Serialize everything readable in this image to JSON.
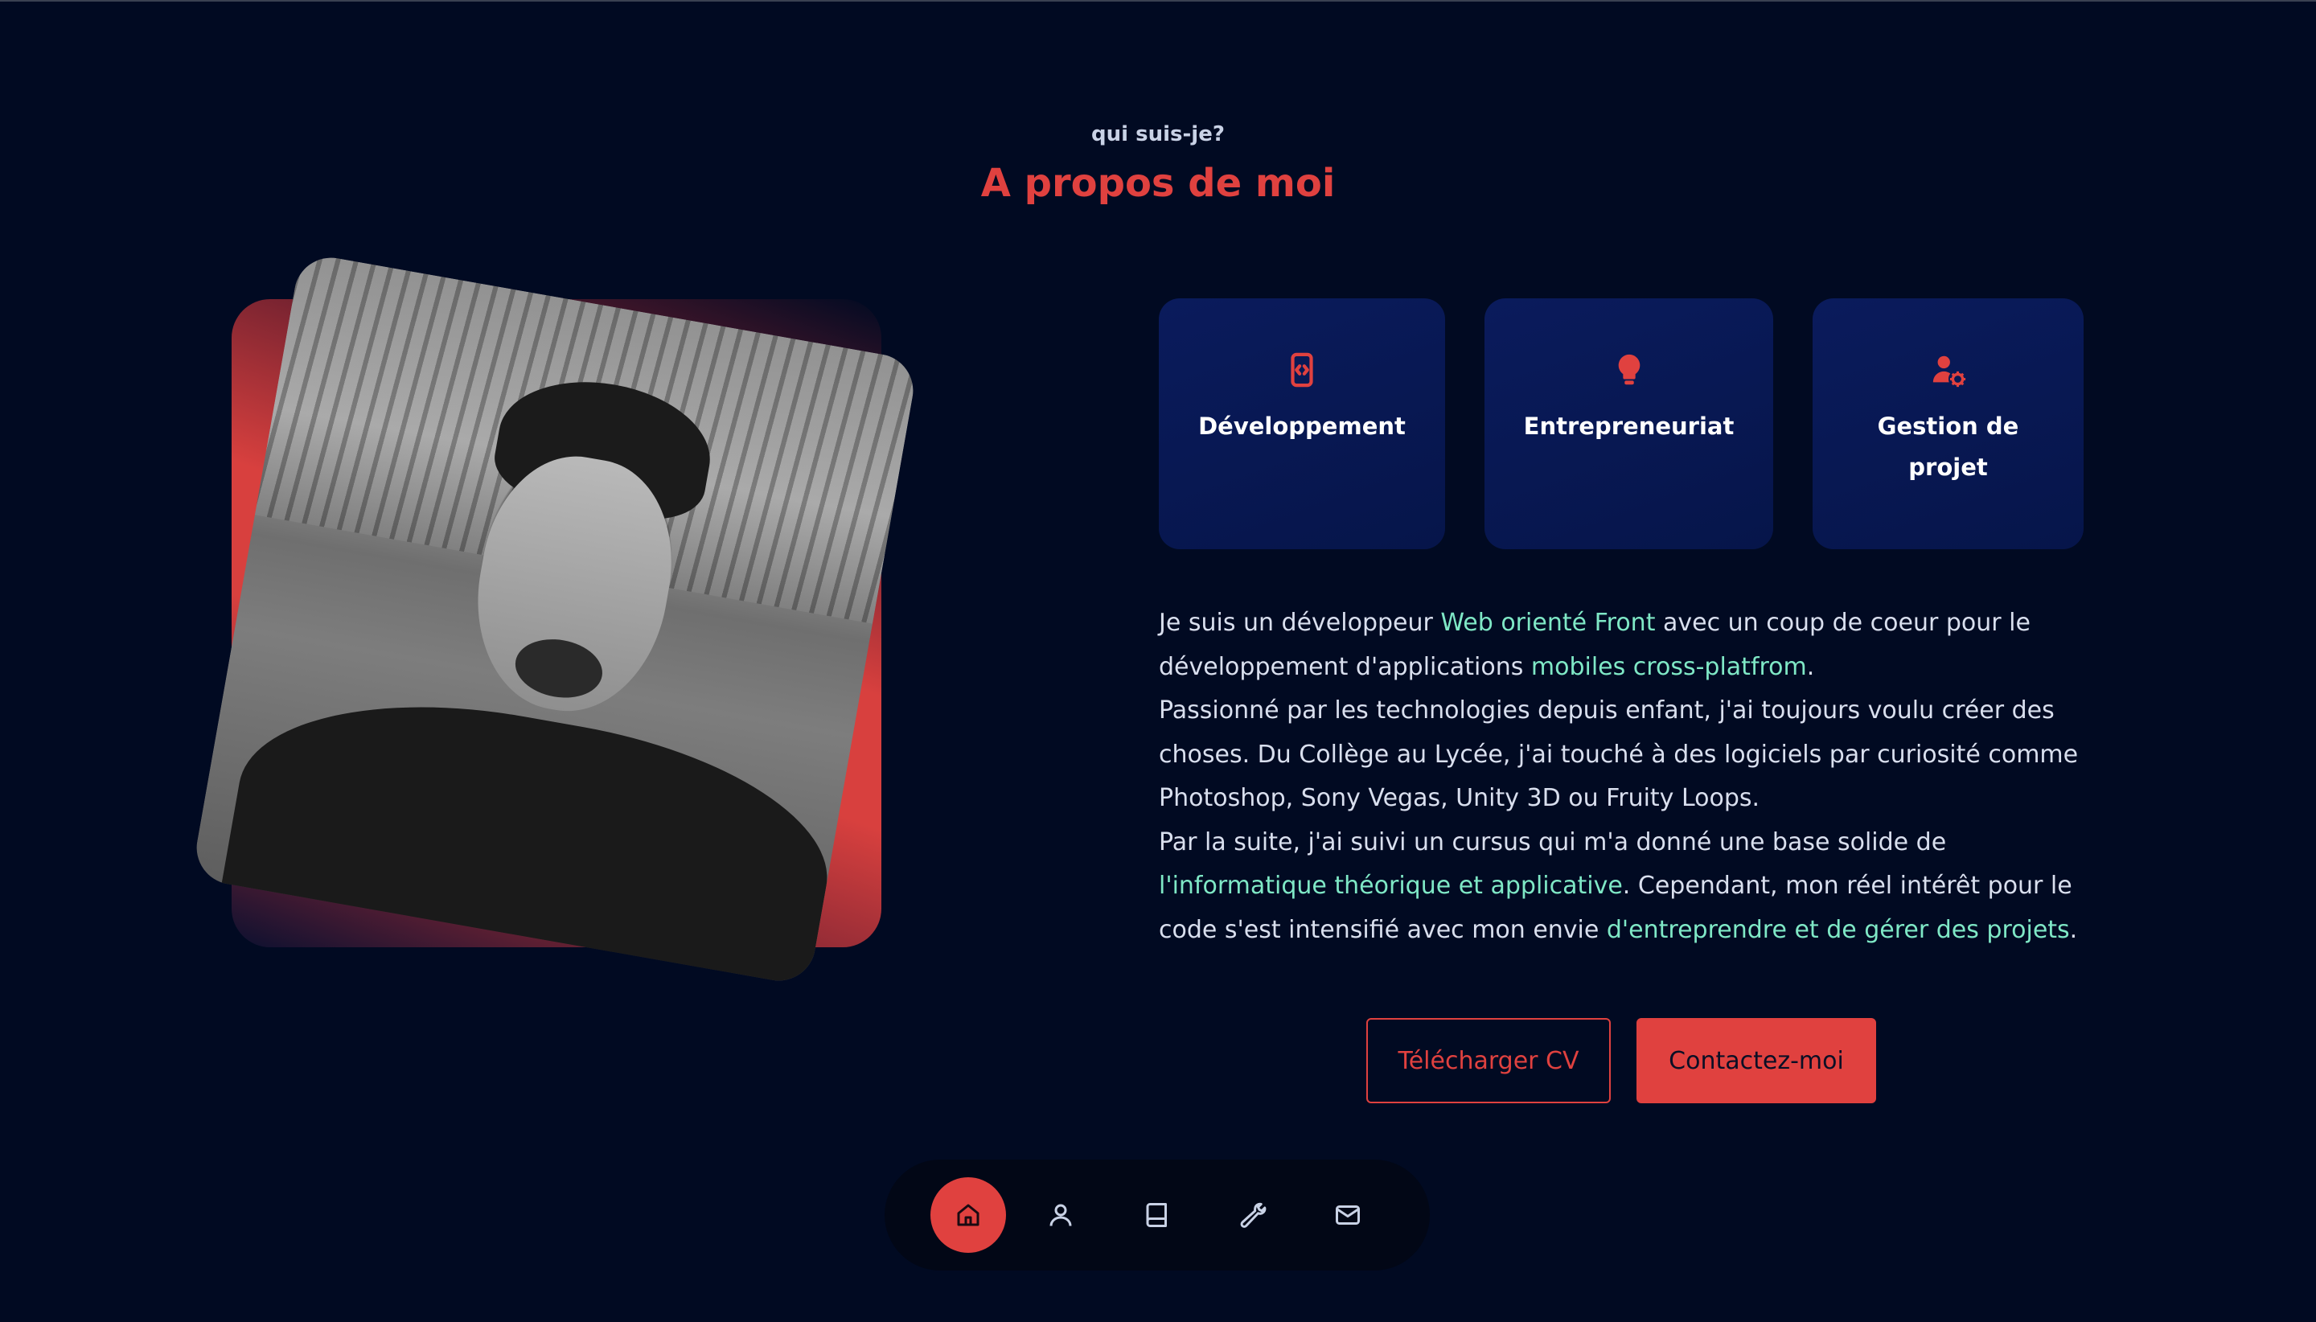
{
  "section": {
    "subtitle": "qui suis-je?",
    "title": "A propos de moi"
  },
  "cards": [
    {
      "icon": "mobile-code-icon",
      "label": "Développement"
    },
    {
      "icon": "lightbulb-icon",
      "label": "Entrepreneuriat"
    },
    {
      "icon": "user-gear-icon",
      "label": "Gestion de projet"
    }
  ],
  "description": {
    "p1": {
      "t1": "Je suis un développeur ",
      "h1": "Web orienté Front",
      "t2": " avec un coup de coeur pour le développement d'applications ",
      "h2": "mobiles cross-platfrom",
      "t3": "."
    },
    "p2": "Passionné par les technologies depuis enfant, j'ai toujours voulu créer des choses. Du Collège au Lycée, j'ai touché à des logiciels par curiosité comme Photoshop, Sony Vegas, Unity 3D ou Fruity Loops.",
    "p3": {
      "t1": "Par la suite, j'ai suivi un cursus qui m'a donné une base solide de ",
      "h1": "l'informatique théorique et applicative",
      "t2": ". Cependant, mon réel intérêt pour le code s'est intensifié avec mon envie ",
      "h2": "d'entreprendre et de gérer des projets",
      "t3": "."
    }
  },
  "buttons": {
    "cv": "Télécharger CV",
    "contact": "Contactez-moi"
  },
  "nav": [
    {
      "icon": "home-icon",
      "active": true
    },
    {
      "icon": "user-icon",
      "active": false
    },
    {
      "icon": "book-icon",
      "active": false
    },
    {
      "icon": "wrench-icon",
      "active": false
    },
    {
      "icon": "mail-icon",
      "active": false
    }
  ],
  "colors": {
    "background": "#010a22",
    "accent": "#e0413f",
    "highlight": "#7fe8c6",
    "card": "#0a1b5c"
  }
}
